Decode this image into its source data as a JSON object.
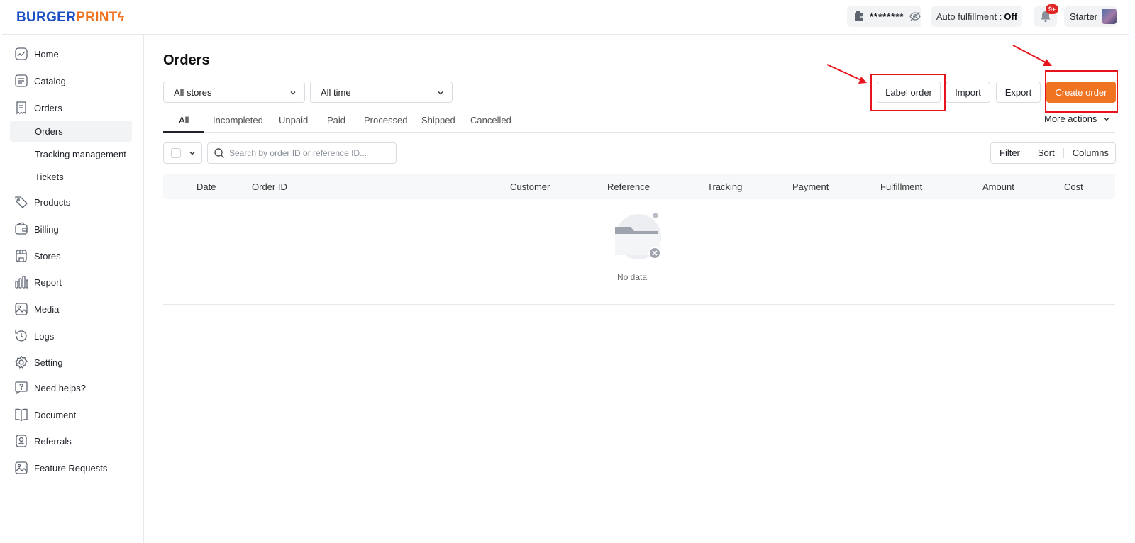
{
  "header": {
    "logo_part1": "BURGER",
    "logo_part2": "PRINT",
    "balance_mask": "********",
    "auto_fulfillment_label": "Auto fulfillment :",
    "auto_fulfillment_value": "Off",
    "notification_count": "9+",
    "plan": "Starter"
  },
  "sidebar": {
    "items": [
      {
        "label": "Home",
        "icon": "home-icon"
      },
      {
        "label": "Catalog",
        "icon": "catalog-icon"
      },
      {
        "label": "Orders",
        "icon": "orders-icon"
      },
      {
        "label": "Products",
        "icon": "products-icon"
      },
      {
        "label": "Billing",
        "icon": "billing-icon"
      },
      {
        "label": "Stores",
        "icon": "stores-icon"
      },
      {
        "label": "Report",
        "icon": "report-icon"
      },
      {
        "label": "Media",
        "icon": "media-icon"
      },
      {
        "label": "Logs",
        "icon": "logs-icon"
      },
      {
        "label": "Setting",
        "icon": "setting-icon"
      },
      {
        "label": "Need helps?",
        "icon": "help-icon"
      },
      {
        "label": "Document",
        "icon": "document-icon"
      },
      {
        "label": "Referrals",
        "icon": "referrals-icon"
      },
      {
        "label": "Feature Requests",
        "icon": "feature-requests-icon"
      }
    ],
    "orders_subitems": [
      {
        "label": "Orders",
        "active": true
      },
      {
        "label": "Tracking management",
        "active": false
      },
      {
        "label": "Tickets",
        "active": false
      }
    ]
  },
  "main": {
    "title": "Orders",
    "store_select": "All stores",
    "time_select": "All time",
    "buttons": {
      "label_order": "Label order",
      "import": "Import",
      "export": "Export",
      "create_order": "Create order",
      "more_actions": "More actions"
    },
    "tabs": [
      "All",
      "Incompleted",
      "Unpaid",
      "Paid",
      "Processed",
      "Shipped",
      "Cancelled"
    ],
    "active_tab": "All",
    "search_placeholder": "Search by order ID or reference ID...",
    "toolbar": {
      "filter": "Filter",
      "sort": "Sort",
      "columns": "Columns"
    },
    "columns": [
      "Date",
      "Order ID",
      "Customer",
      "Reference",
      "Tracking",
      "Payment",
      "Fulfillment",
      "Amount",
      "Cost"
    ],
    "empty_text": "No data"
  },
  "colors": {
    "brand_blue": "#1d4fc4",
    "brand_orange": "#f07322",
    "annotation_red": "#e8141d"
  }
}
